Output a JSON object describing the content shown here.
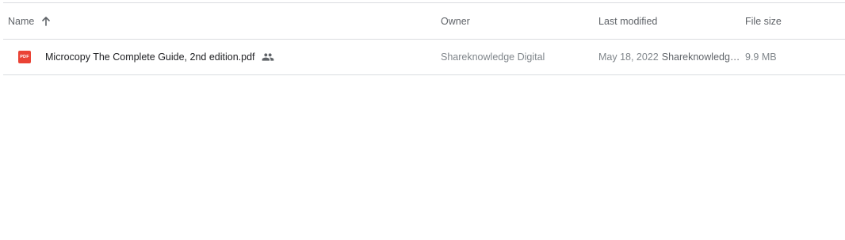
{
  "columns": {
    "name": "Name",
    "owner": "Owner",
    "last_modified": "Last modified",
    "file_size": "File size"
  },
  "sort": {
    "column": "name",
    "direction": "ascending",
    "icon": "arrow-up-icon"
  },
  "files": [
    {
      "icon": "pdf-icon",
      "icon_text": "PDF",
      "name": "Microcopy The Complete Guide, 2nd edition.pdf",
      "shared_icon": "people-icon",
      "owner": "Shareknowledge Digital",
      "modified_date": "May 18, 2022",
      "modified_by": "Shareknowledge…",
      "size": "9.9 MB"
    }
  ],
  "colors": {
    "pdf_red": "#ea4335",
    "divider": "#dadce0",
    "text_primary": "#202124",
    "text_secondary": "#5f6368"
  }
}
